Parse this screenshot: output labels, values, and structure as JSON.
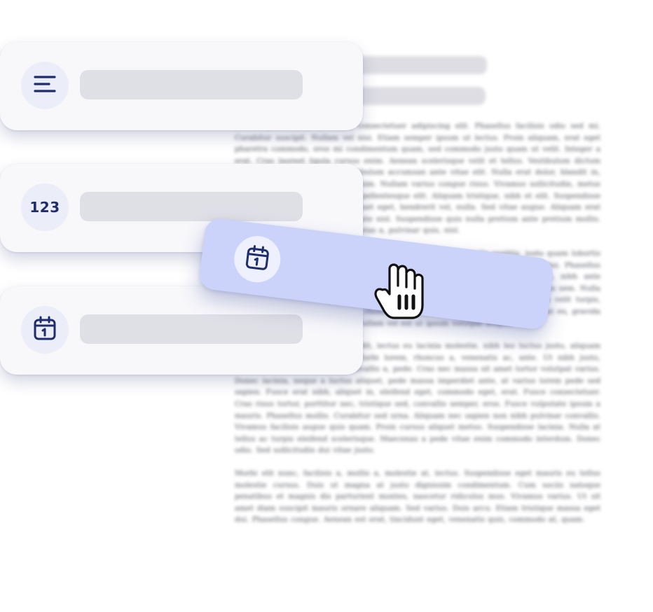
{
  "document": {
    "paragraphs": [
      "Lorem ipsum dolor sit amet, consectetuer adipiscing elit. Phasellus facilisis odio sed mi. Curabitur suscipit. Nullam vel nisi. Etiam semper ipsum ut lectus. Proin aliquam, erat eget pharetra commodo, eros mi condimentum quam, sed commodo justo quam ut velit. Integer a erat. Cras laoreet ligula cursus enim. Aenean scelerisque velit et tellus. Vestibulum dictum aliquet sem. Nulla facilisi. Vestibulum accumsan ante vitae elit. Nulla erat dolor, blandit in, rutrum quis, semper pulvinar, enim. Nullam varius congue risus. Vivamus sollicitudin, metus ut interdum eleifend, nisi tellus pellentesque elit. Aliquam tristique, nibh et elit. Suspendisse libero odio, mattis sit amet, aliquet eget, hendrerit vel, nulla. Sed vitae augue. Aliquam erat volutpat. Aliquam feugiat vulputate nisl. Suspendisse quis nulla pretium ante pretium mollis. Proin velit ligula, sagittis at, egestas a, pulvinar quis, nisl.",
      "Pellentesque sit amet lectus. Praesent pulvinar, nunc quis iaculis sagittis, justo quam lobortis tortor, sed vestibulum dui metus venenatis est. Nunc cursus ligula. Nulla facilisi. Phasellus ullamcorper consectetuer ante. Duis tincidunt, urna id condimentum luctus, nibh ante vulputate sapien, id sagittis massa orci ut enim. Pellentesque vestibulum convallis sem. Nulla consequat quam ut nisl. Nullam est. Curabitur tincidunt dapibus lorem. Proin velit turpis, scelerisque sit amet, iaculis nec, rhoncus ac, ipsum. Phasellus lorem arcu, feugiat eu, gravida eu, consequat molestie, ipsum. Nullam vel est ut ipsum volutpat feugiat.",
      "Aenean sed diam. Vivamus blandit, lectus eu lacinia molestie, nibh leo luctus justo, aliquam ultricies ante turpis a enim. Morbi lorem, rhoncus a, venenatis ac, ante. Ut nibh justo, commodo vel, tincidunt sed, convallis a, pede. Cras nec massa sit amet tortor volutpat varius. Donec lacinia, neque a luctus aliquet, pede massa imperdiet ante, at varius lorem pede sed sapien. Fusce erat nibh, aliquet in, eleifend eget, commodo eget, erat. Fusce consectetuer. Cras risus tortor, porttitor nec, tristique sed, convallis semper, eros. Fusce vulputate ipsum a mauris. Phasellus mollis. Curabitur sed urna. Aliquam nec sapien non nibh pulvinar convallis. Vivamus facilisis augue quis quam. Proin cursus aliquet metus. Suspendisse lacinia. Nulla at tellus ac turpis eleifend scelerisque. Maecenas a pede vitae enim commodo interdum. Donec odio. Sed sollicitudin dui vitae justo.",
      "Morbi elit nunc, facilisis a, mollis a, molestie at, lectus. Suspendisse eget mauris eu tellus molestie cursus. Duis ut magna at justo dignissim condimentum. Cum sociis natoque penatibus et magnis dis parturient montes, nascetur ridiculus mus. Vivamus varius. Ut sit amet diam suscipit mauris ornare aliquam. Sed varius. Duis arcu. Etiam tristique massa eget dui. Phasellus congue. Aenean est erat, tincidunt eget, venenatis quis, commodo at, quam."
    ]
  },
  "field_types": [
    {
      "name": "text-field-type",
      "icon": "text-lines-icon"
    },
    {
      "name": "number-field-type",
      "icon": "number-icon",
      "icon_text": "123"
    },
    {
      "name": "date-field-type",
      "icon": "calendar-icon"
    }
  ],
  "dragged_item": {
    "icon": "calendar-icon",
    "cursor": "grab-hand-cursor-icon"
  },
  "colors": {
    "card_background": "#f8f8fb",
    "icon_circle": "#ebedf8",
    "icon_color": "#1f2d6a",
    "placeholder_bar": "#dfdfe6",
    "drag_card": "#cbd3fb",
    "document_text": "#4f5158"
  }
}
